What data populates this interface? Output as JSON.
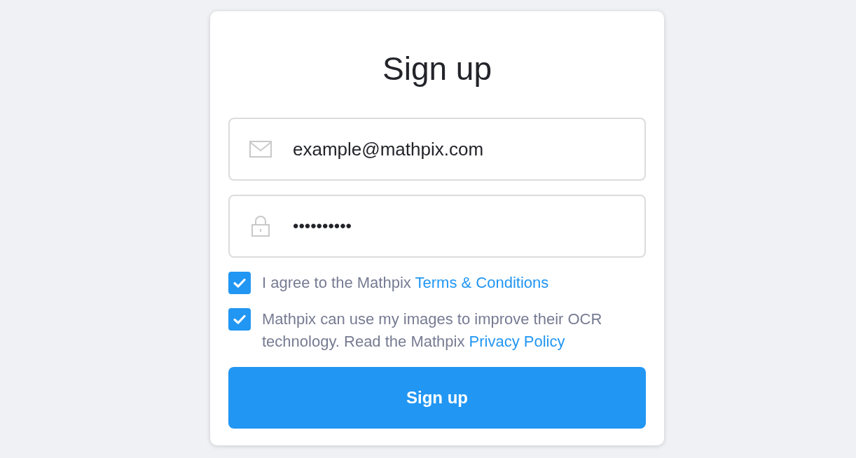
{
  "form": {
    "title": "Sign up",
    "fields": [
      {
        "kind": "email",
        "value": "example@mathpix.com"
      },
      {
        "kind": "password",
        "value": "••••••••••"
      }
    ],
    "agreements": [
      {
        "text": "I agree to the Mathpix",
        "link": "Terms & Conditions",
        "checked": true
      },
      {
        "text": "Mathpix can use my images to improve their OCR technology. Read the Mathpix",
        "link": "Privacy Policy",
        "checked": true
      }
    ],
    "submit": {
      "label": "Sign up"
    }
  }
}
